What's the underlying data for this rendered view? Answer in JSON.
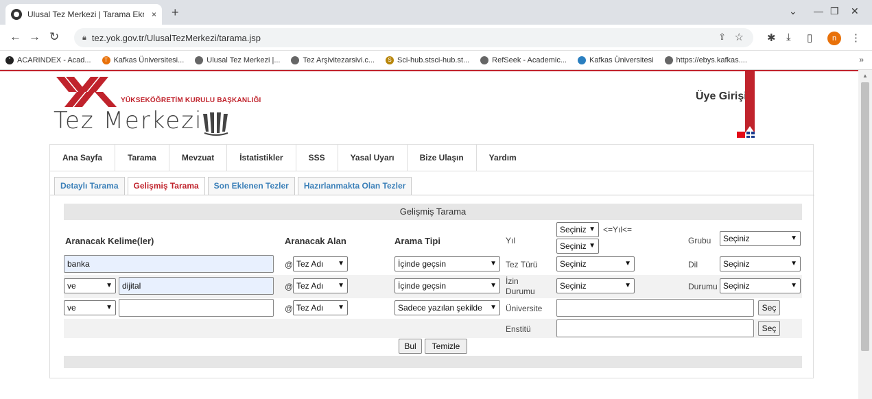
{
  "browser": {
    "tab_title": "Ulusal Tez Merkezi | Tarama Ekran",
    "tab_close": "×",
    "new_tab": "+",
    "url": "tez.yok.gov.tr/UlusalTezMerkezi/tarama.jsp",
    "avatar_letter": "n",
    "bookmarks": [
      "ACARINDEX - Acad...",
      "Kafkas Üniversitesi...",
      "Ulusal Tez Merkezi |...",
      "Tez Arşivitezarsivi.c...",
      "Sci-hub.stsci-hub.st...",
      "RefSeek - Academic...",
      "Kafkas Üniversitesi",
      "https://ebys.kafkas...."
    ],
    "bookmarks_more": "»"
  },
  "header": {
    "org_name": "YÜKSEKÖĞRETİM KURULU BAŞKANLIĞI",
    "site_title": "Tez Merkezi",
    "login": "Üye Girişi"
  },
  "menu": [
    "Ana Sayfa",
    "Tarama",
    "Mevzuat",
    "İstatistikler",
    "SSS",
    "Yasal Uyarı",
    "Bize Ulaşın",
    "Yardım"
  ],
  "tabs": [
    {
      "label": "Detaylı Tarama",
      "active": false
    },
    {
      "label": "Gelişmiş Tarama",
      "active": true
    },
    {
      "label": "Son Eklenen Tezler",
      "active": false
    },
    {
      "label": "Hazırlanmakta Olan Tezler",
      "active": false
    }
  ],
  "form": {
    "heading": "Gelişmiş Tarama",
    "col_keywords": "Aranacak Kelime(ler)",
    "col_field": "Aranacak Alan",
    "col_type": "Arama Tipi",
    "year_label": "Yıl",
    "year_from": "Seçiniz",
    "year_to": "Seçiniz",
    "year_range_text": "<=Yıl<=",
    "group_label": "Grubu",
    "group_value": "Seçiniz",
    "rows": [
      {
        "op": "",
        "keyword": "banka",
        "at": "@",
        "field": "Tez Adı",
        "type": "İçinde geçsin"
      },
      {
        "op": "ve",
        "keyword": "dijital",
        "at": "@",
        "field": "Tez Adı",
        "type": "İçinde geçsin"
      },
      {
        "op": "ve",
        "keyword": "",
        "at": "@",
        "field": "Tez Adı",
        "type": "Sadece yazılan şekilde"
      }
    ],
    "thesis_type_label": "Tez Türü",
    "thesis_type_value": "Seçiniz",
    "language_label": "Dil",
    "language_value": "Seçiniz",
    "permission_label_1": "İzin",
    "permission_label_2": "Durumu",
    "permission_value": "Seçiniz",
    "status_label": "Durumu",
    "status_value": "Seçiniz",
    "university_label": "Üniversite",
    "institute_label": "Enstitü",
    "select_button": "Seç",
    "find_button": "Bul",
    "clear_button": "Temizle"
  }
}
